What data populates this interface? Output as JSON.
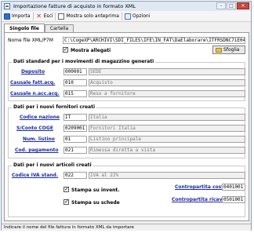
{
  "window": {
    "title": "Importazione fatture di acquisto in formato XML",
    "btn_min": "–",
    "btn_max": "□",
    "btn_close": "✕"
  },
  "toolbar": {
    "importa": "Importa",
    "esci": "Esci",
    "mostra": "Mostra solo anteprima",
    "opzioni": "Opzioni"
  },
  "tabs": [
    {
      "label": "Singolo file"
    },
    {
      "label": "Cartella"
    }
  ],
  "file": {
    "label": "Nome file XML/P7M",
    "value": "C:\\CogeXP\\ARCHIVI\\SDI_FILES\\IFE\\IN_FAT\\DaElaborare\\ITFRSDNC71E04",
    "mostra_allegati": "Mostra allegati",
    "sfoglia": "Sfoglia"
  },
  "magazzino": {
    "title": "Dati standard per i movimenti di magazzino generati",
    "deposito_label": "Deposito",
    "deposito_code": "000001",
    "deposito_desc": "SEDE",
    "causale_fatt_label": "Causale fatt.acq.",
    "causale_fatt_code": "010",
    "causale_fatt_desc": "Acquisto",
    "causale_nc_label": "Causale n.acc.acq.",
    "causale_nc_code": "015",
    "causale_nc_desc": "Reso a fornitore"
  },
  "fornitori": {
    "title": "Dati per i nuovi fornitori creati",
    "nazione_label": "Codice nazione",
    "nazione_code": "IT",
    "nazione_desc": "Italia",
    "conto_label": "S/Conto COGE",
    "conto_code": "0209001",
    "conto_desc": "Fornitori Italia",
    "listino_label": "Num. listino",
    "listino_code": "01",
    "listino_desc": "Listino principale",
    "pagamento_label": "Cod. pagamento",
    "pagamento_code": "021",
    "pagamento_desc": "Rimessa diretta a vista"
  },
  "articoli": {
    "title": "Dati per i nuovi articoli creati",
    "iva_label": "Codice IVA stand.",
    "iva_code": "022",
    "iva_desc": "IVA al 22%",
    "stampa_invent": "Stampa su invent.",
    "stampa_schede": "Stampa su schede",
    "contro_costo_label": "Contropartita costo",
    "contro_costo_value": "0401001",
    "contro_ricavo_label": "Contropartita ricavo",
    "contro_ricavo_value": "0501001"
  },
  "status": "Indicare il nome del file fattura in formato XML da importare"
}
